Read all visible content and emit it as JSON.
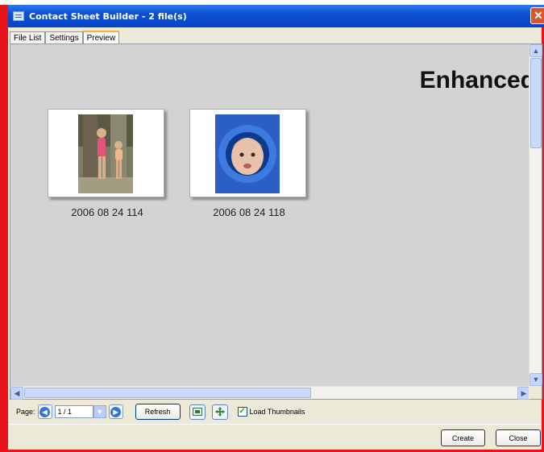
{
  "window": {
    "title": "Contact Sheet Builder - 2 file(s)",
    "close_glyph": "✕"
  },
  "tabs": [
    {
      "label": "File List"
    },
    {
      "label": "Settings"
    },
    {
      "label": "Preview",
      "active": true
    }
  ],
  "preview": {
    "overlay_text": "Enhanced",
    "thumbnails": [
      {
        "caption": "2006 08 24 114"
      },
      {
        "caption": "2006 08 24 118"
      }
    ]
  },
  "toolbar": {
    "page_label": "Page:",
    "page_value": "1 / 1",
    "refresh_label": "Refresh",
    "load_thumbnails_label": "Load Thumbnails",
    "load_thumbnails_checked": true
  },
  "footer": {
    "create_label": "Create",
    "close_label": "Close"
  },
  "colors": {
    "window_border": "#e8141b",
    "titlebar": "#0a4fd3",
    "preview_bg": "#d3d3d3"
  }
}
